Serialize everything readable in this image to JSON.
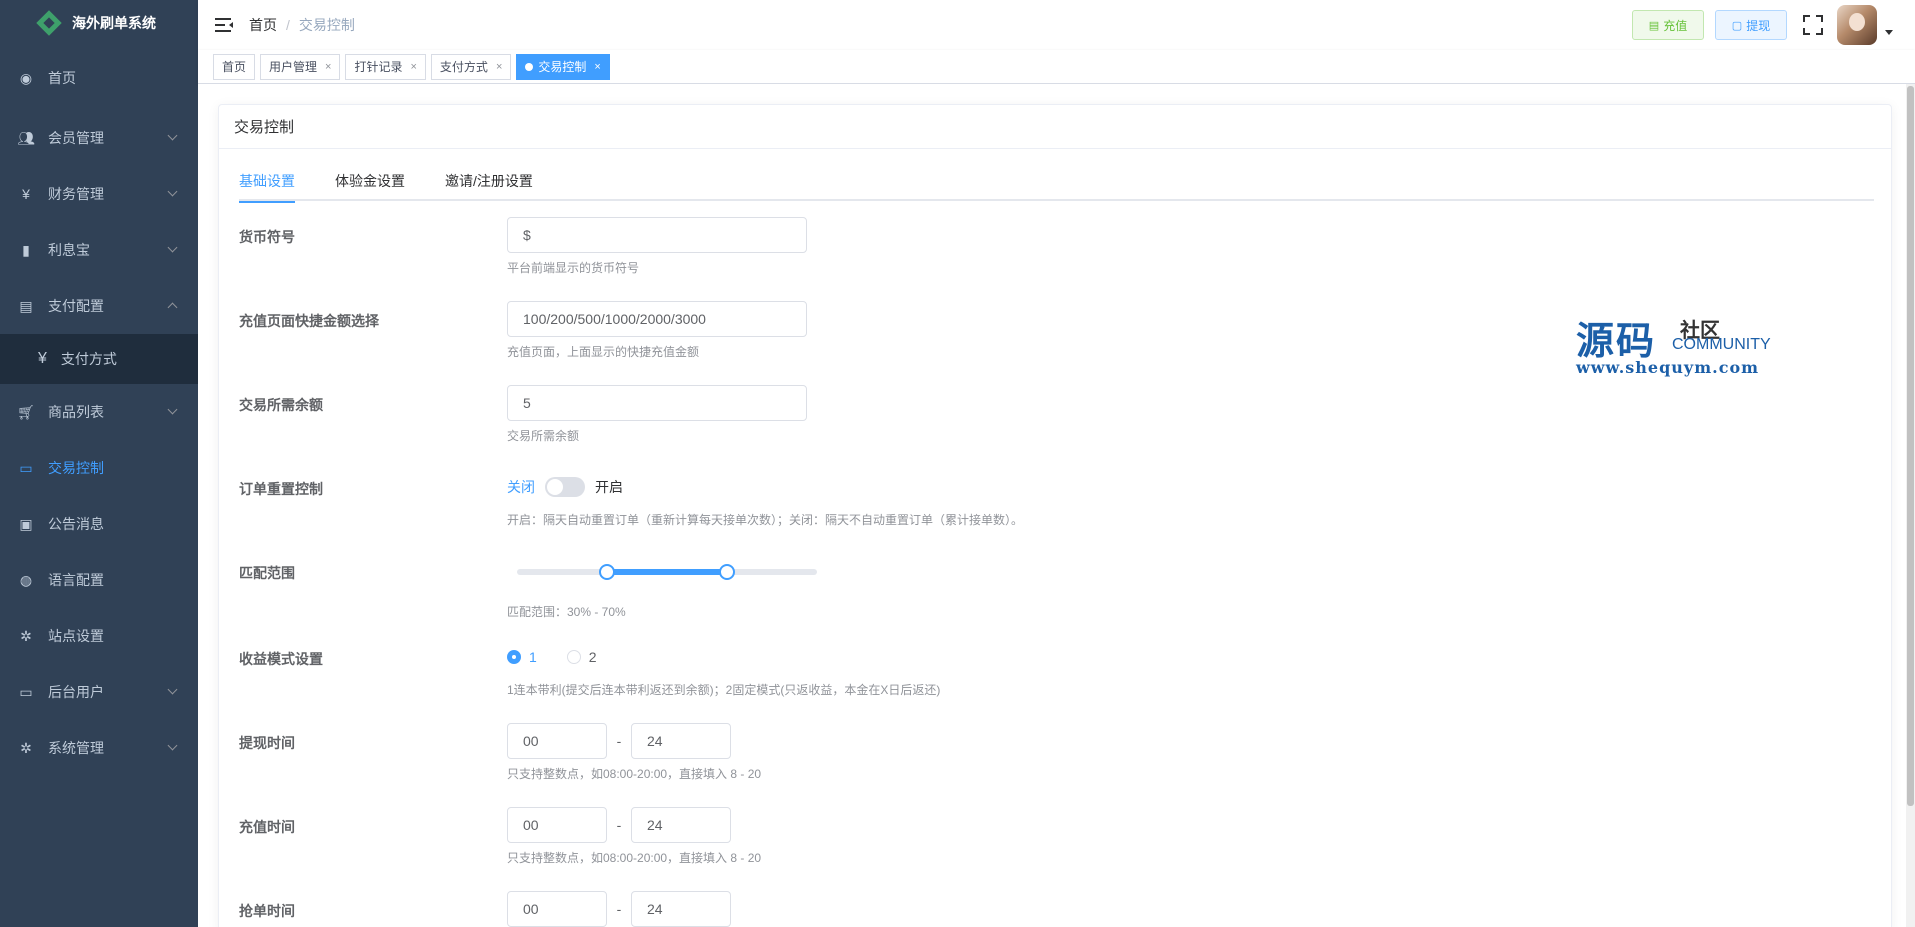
{
  "app": {
    "title": "海外刷单系统"
  },
  "sidebar": {
    "items": [
      {
        "label": "首页",
        "icon": "dashboard-icon"
      },
      {
        "label": "会员管理",
        "icon": "users-icon"
      },
      {
        "label": "财务管理",
        "icon": "yen-icon"
      },
      {
        "label": "利息宝",
        "icon": "bar-chart-icon"
      },
      {
        "label": "支付配置",
        "icon": "payment-icon"
      },
      {
        "label": "支付方式",
        "icon": "yen-icon"
      },
      {
        "label": "商品列表",
        "icon": "cart-icon"
      },
      {
        "label": "交易控制",
        "icon": "monitor-icon"
      },
      {
        "label": "公告消息",
        "icon": "message-icon"
      },
      {
        "label": "语言配置",
        "icon": "globe-icon"
      },
      {
        "label": "站点设置",
        "icon": "gear-icon"
      },
      {
        "label": "后台用户",
        "icon": "monitor-icon"
      },
      {
        "label": "系统管理",
        "icon": "gear-icon"
      }
    ]
  },
  "navbar": {
    "breadcrumb": {
      "home": "首页",
      "separator": "/",
      "current": "交易控制"
    },
    "recharge_label": "充值",
    "withdraw_label": "提现"
  },
  "tags": [
    {
      "label": "首页"
    },
    {
      "label": "用户管理",
      "close": "×"
    },
    {
      "label": "打针记录",
      "close": "×"
    },
    {
      "label": "支付方式",
      "close": "×"
    },
    {
      "label": "交易控制",
      "close": "×"
    }
  ],
  "card": {
    "title": "交易控制"
  },
  "tabs": [
    "基础设置",
    "体验金设置",
    "邀请/注册设置"
  ],
  "form": {
    "currency": {
      "label": "货币符号",
      "value": "$",
      "help": "平台前端显示的货币符号"
    },
    "quick_amounts": {
      "label": "充值页面快捷金额选择",
      "value": "100/200/500/1000/2000/3000",
      "help": "充值页面，上面显示的快捷充值金额"
    },
    "min_balance": {
      "label": "交易所需余额",
      "value": "5",
      "help": "交易所需余额"
    },
    "order_reset": {
      "label": "订单重置控制",
      "off": "关闭",
      "on": "开启",
      "enabled": false,
      "help": "开启：隔天自动重置订单（重新计算每天接单次数）；关闭：隔天不自动重置订单（累计接单数）。"
    },
    "match_range": {
      "label": "匹配范围",
      "min": 30,
      "max": 70,
      "help": "匹配范围：30% - 70%"
    },
    "income_mode": {
      "label": "收益模式设置",
      "options": [
        "1",
        "2"
      ],
      "selected": "1",
      "help": "1连本带利(提交后连本带利返还到余额)；2固定模式(只返收益，本金在X日后返还)"
    },
    "withdraw_time": {
      "label": "提现时间",
      "start": "00",
      "dash": "-",
      "end": "24",
      "help": "只支持整数点，如08:00-20:00，直接填入 8 - 20"
    },
    "recharge_time": {
      "label": "充值时间",
      "start": "00",
      "dash": "-",
      "end": "24",
      "help": "只支持整数点，如08:00-20:00，直接填入 8 - 20"
    },
    "grab_time": {
      "label": "抢单时间",
      "start": "00",
      "dash": "-",
      "end": "24"
    }
  },
  "watermark": {
    "big": "源码",
    "small": "社区",
    "community": "COMMUNITY",
    "url": "www.shequym.com"
  },
  "colors": {
    "sidebar_bg": "#304156",
    "accent": "#409eff",
    "success": "#67c23a"
  }
}
